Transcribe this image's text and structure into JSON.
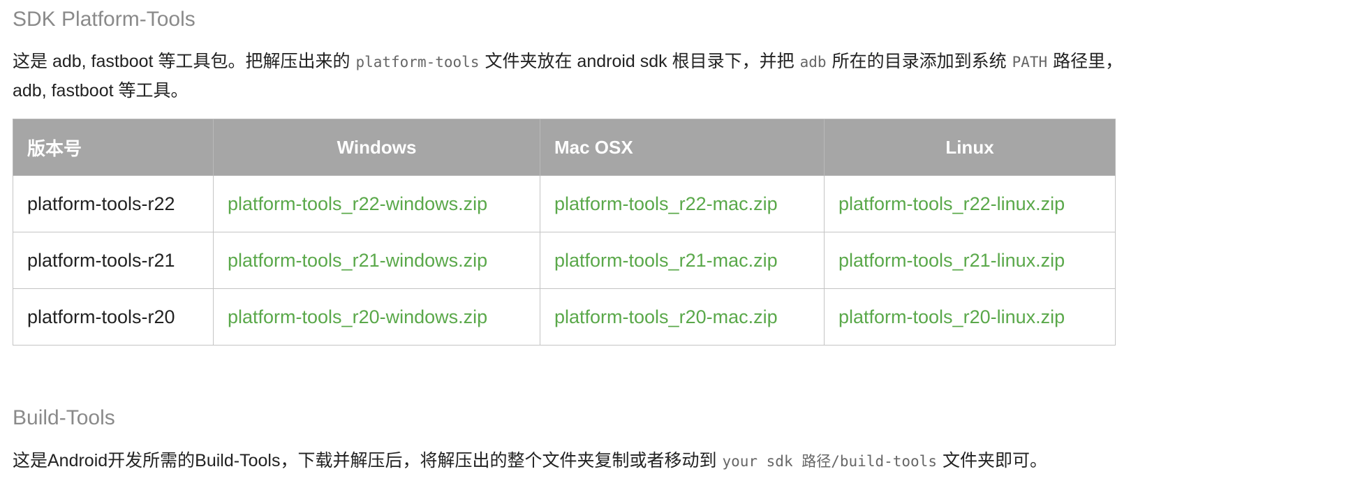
{
  "sdk_section": {
    "title": "SDK Platform-Tools",
    "desc_part1": "这是 adb, fastboot 等工具包。把解压出来的",
    "desc_code1": "platform-tools",
    "desc_part2": "文件夹放在 android sdk 根目录下，并把",
    "desc_code2": "adb",
    "desc_part3": "所在的目录添加到系统",
    "desc_code3": "PATH",
    "desc_part4": "路径里，",
    "desc_line2": "adb, fastboot 等工具。"
  },
  "table": {
    "headers": [
      "版本号",
      "Windows",
      "Mac OSX",
      "Linux"
    ],
    "rows": [
      {
        "version": "platform-tools-r22",
        "windows": "platform-tools_r22-windows.zip",
        "mac": "platform-tools_r22-mac.zip",
        "linux": "platform-tools_r22-linux.zip"
      },
      {
        "version": "platform-tools-r21",
        "windows": "platform-tools_r21-windows.zip",
        "mac": "platform-tools_r21-mac.zip",
        "linux": "platform-tools_r21-linux.zip"
      },
      {
        "version": "platform-tools-r20",
        "windows": "platform-tools_r20-windows.zip",
        "mac": "platform-tools_r20-mac.zip",
        "linux": "platform-tools_r20-linux.zip"
      }
    ]
  },
  "build_section": {
    "title": "Build-Tools",
    "desc_part1": "这是Android开发所需的Build-Tools，下载并解压后，将解压出的整个文件夹复制或者移动到",
    "desc_code1": "your sdk 路径/build-tools",
    "desc_part2": "文件夹即可。"
  },
  "colors": {
    "link": "#5aa84a",
    "header_bg": "#a6a6a6",
    "heading": "#8a8a8a"
  }
}
